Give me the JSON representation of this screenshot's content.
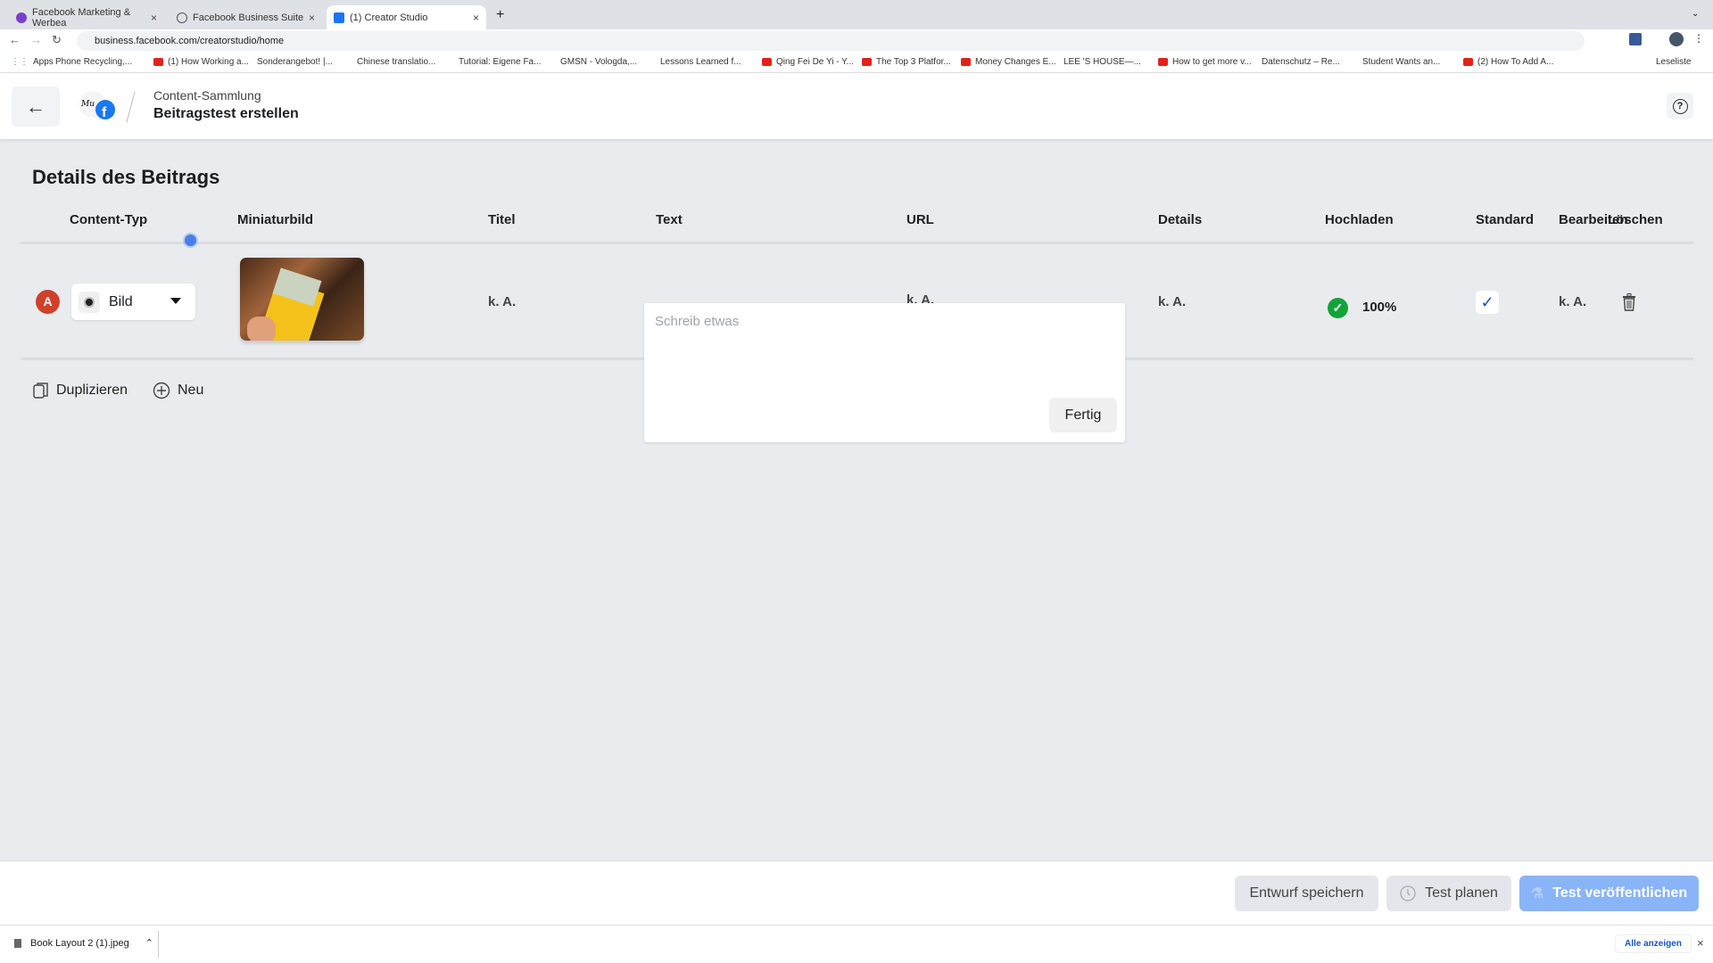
{
  "browser": {
    "tabs": [
      {
        "label": "Facebook Marketing & Werbea",
        "color": "#7b3fc9"
      },
      {
        "label": "Facebook Business Suite",
        "color": "#555"
      },
      {
        "label": "(1) Creator Studio",
        "color": "#1877f2",
        "active": true
      }
    ],
    "url": "business.facebook.com/creatorstudio/home",
    "bookmarks": [
      "Apps",
      "Phone Recycling,...",
      "(1) How Working a...",
      "Sonderangebot! |...",
      "Chinese translatio...",
      "Tutorial: Eigene Fa...",
      "GMSN - Vologda,...",
      "Lessons Learned f...",
      "Qing Fei De Yi - Y...",
      "The Top 3 Platfor...",
      "Money Changes E...",
      "LEE 'S HOUSE—...",
      "How to get more v...",
      "Datenschutz – Re...",
      "Student Wants an...",
      "(2) How To Add A..."
    ],
    "reading_list": "Leseliste"
  },
  "header": {
    "breadcrumb": "Content-Sammlung",
    "title": "Beitragstest erstellen"
  },
  "section_title": "Details des Beitrags",
  "columns": [
    "Content-Typ",
    "Miniaturbild",
    "Titel",
    "Text",
    "URL",
    "Details",
    "Hochladen",
    "Standard",
    "Bearbeiten",
    "Löschen"
  ],
  "row": {
    "avatar": "A",
    "content_type": "Bild",
    "title": "k. A.",
    "url": "k. A.",
    "details": "k. A.",
    "upload_progress": "100%",
    "standard_checked": true,
    "edit": "k. A."
  },
  "actions": {
    "duplicate": "Duplizieren",
    "new": "Neu"
  },
  "text_popup": {
    "placeholder": "Schreib etwas",
    "value": "",
    "done": "Fertig"
  },
  "footer": {
    "save_draft": "Entwurf speichern",
    "schedule": "Test planen",
    "publish": "Test veröffentlichen",
    "publish_color": "#8ab4f8"
  },
  "downloads": {
    "file": "Book Layout 2 (1).jpeg",
    "show_all": "Alle anzeigen"
  }
}
